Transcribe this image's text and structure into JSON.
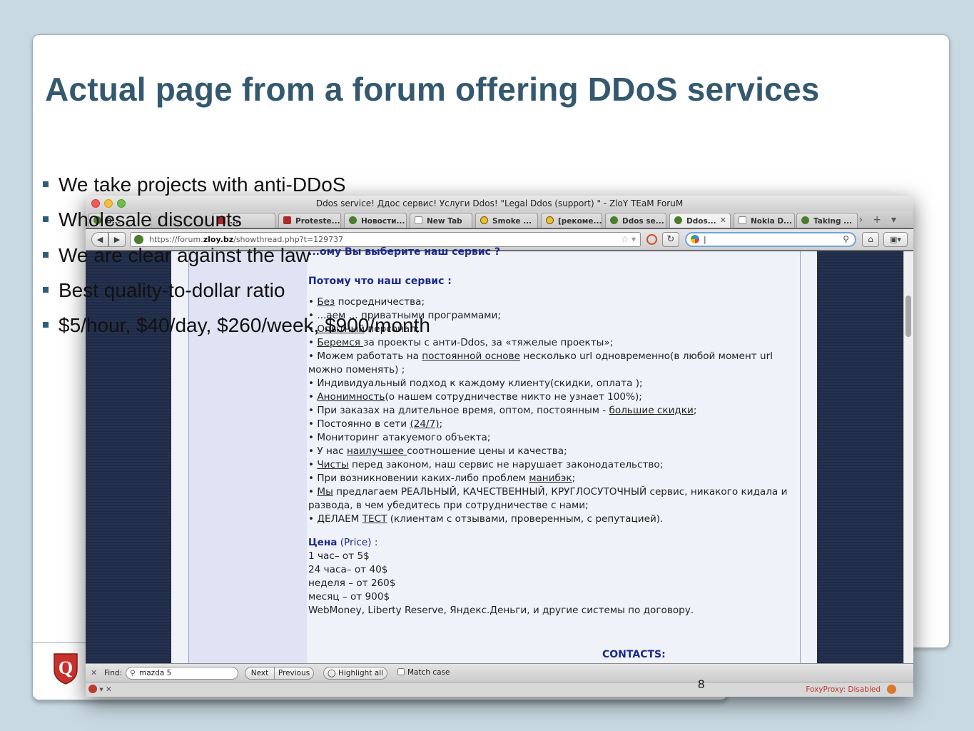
{
  "slide": {
    "title": "Actual page from a forum offering DDoS services",
    "bullets": [
      "We take projects with anti-DDoS",
      "Wholesale discounts",
      "We are clear against the law",
      "Best quality-to-dollar  ratio",
      "$5/hour, $40/day, $260/week, $900/month"
    ],
    "page_number": "8",
    "logo_icon": "q-shield-logo",
    "accent_color": "#34596f"
  },
  "browser": {
    "window_title": "Ddos service! Ддос сервис! Услуги Ddos! \"Legal Ddos (support) \" - ZloY TEaM ForuM",
    "tabs": [
      {
        "label": "O...",
        "icon": "tab-icon"
      },
      {
        "label": "...",
        "icon": "tab-icon"
      },
      {
        "label": "Proteste...",
        "icon": "vb-icon"
      },
      {
        "label": "Новости...",
        "icon": "tab-icon"
      },
      {
        "label": "New Tab",
        "icon": "blank-page-icon"
      },
      {
        "label": "Smoke ...",
        "icon": "radiation-icon"
      },
      {
        "label": "[рекоме...",
        "icon": "radiation-icon"
      },
      {
        "label": "Ddos se...",
        "icon": "tab-icon"
      },
      {
        "label": "Ddos...",
        "icon": "tab-icon",
        "active": true
      },
      {
        "label": "Nokia D...",
        "icon": "blank-page-icon"
      },
      {
        "label": "Taking ...",
        "icon": "tab-icon"
      }
    ],
    "url_prefix": "https://forum.",
    "url_domain": "zloy.bz",
    "url_path": "/showthread.php?t=129737",
    "search_value": "|",
    "find": {
      "label": "Find:",
      "value": "mazda 5",
      "next": "Next",
      "previous": "Previous",
      "highlight_all": "Highlight all",
      "match_case": "Match case"
    },
    "status": {
      "foxyproxy": "FoxyProxy: Disabled"
    }
  },
  "forum_page": {
    "heading1": "...ому Вы выберите наш сервис ?",
    "heading2": "Потому что наш сервис :",
    "items": [
      {
        "pre": "• ",
        "u": "Без",
        "post": " посредничества;"
      },
      {
        "pre": "• ",
        "u": "",
        "post": "...аем ... приватными программами;"
      },
      {
        "pre": "• ",
        "u": "Опытный",
        "post": " персонал;"
      },
      {
        "pre": "• ",
        "u": "Беремся ",
        "post": "за проекты с анти-Ddos, за «тяжелые проекты»;"
      },
      {
        "pre": "• Можем работать на ",
        "u": "постоянной основе",
        "post": " несколько url одновременно(в любой момент url можно поменять) ;"
      },
      {
        "pre": "• Индивидуальный подход к каждому клиенту(скидки, оплата );",
        "u": "",
        "post": ""
      },
      {
        "pre": "• ",
        "u": "Анонимность",
        "post": "(о нашем сотрудничестве никто не узнает 100%);"
      },
      {
        "pre": "• При заказах на длительное время, оптом, постоянным - ",
        "u": "большие скидки",
        "post": ";"
      },
      {
        "pre": "• Постоянно в сети ",
        "u": "(24/7)",
        "post": ";"
      },
      {
        "pre": "• Мониторинг атакуемого объекта;",
        "u": "",
        "post": ""
      },
      {
        "pre": "• У нас ",
        "u": "наилучшее ",
        "post": "соотношение цены и качества;"
      },
      {
        "pre": "• ",
        "u": "Чисты",
        "post": " перед законом, наш сервис не нарушает законодательство;"
      },
      {
        "pre": "• При возникновении каких-либо проблем ",
        "u": "манибэк",
        "post": ";"
      },
      {
        "pre": "• ",
        "u": "Мы",
        "post": " предлагаем РЕАЛЬНЫЙ, КАЧЕСТВЕННЫЙ, КРУГЛОСУТОЧНЫЙ сервис, никакого кидала и развода, в чем убедитесь при сотрудничестве с нами;"
      },
      {
        "pre": "• ДЕЛАЕМ ",
        "u": "ТЕСТ",
        "post": " (клиентам с отзывами, проверенным, с репутацией)."
      }
    ],
    "price_label": "Цена",
    "price_label_en": "(Price)",
    "price_lines": [
      "1 час– от 5$",
      "24 часа– от 40$",
      "неделя – от 260$",
      "месяц – от 900$",
      "WebMoney, Liberty Reserve, Яндекс.Деньги, и другие системы по договору."
    ],
    "contacts": "CONTACTS:"
  }
}
